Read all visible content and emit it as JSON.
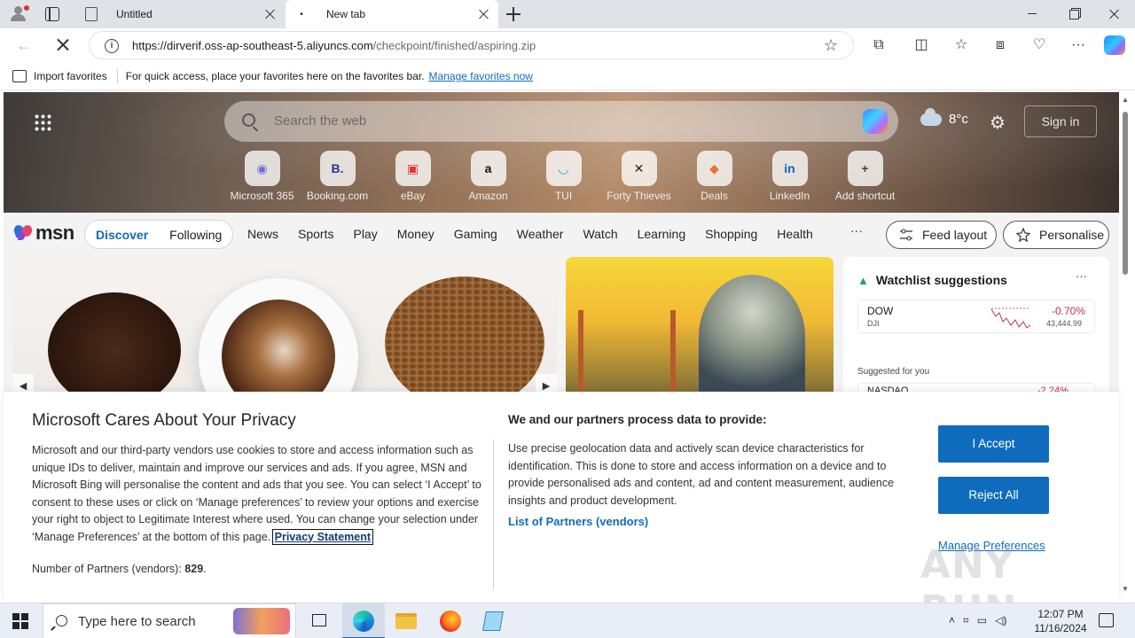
{
  "browser": {
    "tabs": [
      {
        "title": "Untitled",
        "active": false
      },
      {
        "title": "New tab",
        "active": true
      }
    ],
    "address": {
      "host": "https://dirverif.oss-ap-southeast-5.aliyuncs.com",
      "path": "/checkpoint/finished/aspiring.zip"
    },
    "favorites_bar": {
      "import_label": "Import favorites",
      "message": "For quick access, place your favorites here on the favorites bar.",
      "manage_link": "Manage favorites now"
    }
  },
  "msn": {
    "search_placeholder": "Search the web",
    "weather": {
      "temp": "8°c"
    },
    "signin": "Sign in",
    "shortcuts": [
      {
        "label": "Microsoft 365",
        "icon": "microsoft365-icon",
        "glyph": "◉",
        "color": "#6b6fd8"
      },
      {
        "label": "Booking.com",
        "icon": "booking-icon",
        "glyph": "B.",
        "color": "#1d3b8f"
      },
      {
        "label": "eBay",
        "icon": "ebay-icon",
        "glyph": "▣",
        "color": "#e53238"
      },
      {
        "label": "Amazon",
        "icon": "amazon-icon",
        "glyph": "a",
        "color": "#111111"
      },
      {
        "label": "TUI",
        "icon": "tui-icon",
        "glyph": "◡",
        "color": "#2ea8e0"
      },
      {
        "label": "Forty Thieves",
        "icon": "forty-thieves-icon",
        "glyph": "✕",
        "color": "#222222"
      },
      {
        "label": "Deals",
        "icon": "deals-icon",
        "glyph": "◆",
        "color": "#e2733a"
      },
      {
        "label": "LinkedIn",
        "icon": "linkedin-icon",
        "glyph": "in",
        "color": "#0a66c2"
      },
      {
        "label": "Add shortcut",
        "icon": "add-shortcut-icon",
        "glyph": "+",
        "color": "#444444"
      }
    ],
    "logo": "msn",
    "feed_tabs": {
      "active": "Discover",
      "other": "Following"
    },
    "nav": [
      "News",
      "Sports",
      "Play",
      "Money",
      "Gaming",
      "Weather",
      "Watch",
      "Learning",
      "Shopping",
      "Health"
    ],
    "more": "···",
    "feed_layout": "Feed layout",
    "personalise": "Personalise",
    "watchlist": {
      "title": "Watchlist suggestions",
      "stock": {
        "symbol": "DOW",
        "exchange": "DJI",
        "change": "-0.70%",
        "price": "43,444.99"
      },
      "suggested_label": "Suggested for you",
      "stock2": {
        "symbol": "NASDAQ",
        "change": "-2.24%"
      }
    }
  },
  "consent": {
    "title": "Microsoft Cares About Your Privacy",
    "body": "Microsoft and our third-party vendors use cookies to store and access information such as unique IDs to deliver, maintain and improve our services and ads. If you agree, MSN and Microsoft Bing will personalise the content and ads that you see. You can select ‘I Accept’ to consent to these uses or click on ‘Manage preferences’ to review your options and exercise your right to object to Legitimate Interest where used.  You can change your selection under ‘Manage Preferences’ at the bottom of this page.",
    "privacy_link": "Privacy Statement",
    "partners_label": "Number of Partners (vendors):",
    "partners_count": "829",
    "partners_suffix": ".",
    "heading2": "We and our partners process data to provide:",
    "body2": "Use precise geolocation data and actively scan device characteristics for identification. This is done to store and access information on a device and to provide personalised ads and content, ad and content measurement, audience insights and product development.",
    "vendors_link": "List of Partners (vendors)",
    "accept": "I Accept",
    "reject": "Reject All",
    "manage": "Manage Preferences",
    "watermark": "ANY RUN"
  },
  "taskbar": {
    "search_placeholder": "Type here to search",
    "time": "12:07 PM",
    "date": "11/16/2024"
  },
  "colors": {
    "accent": "#0f6cbd",
    "negative": "#c4314b",
    "positive": "#23a55a"
  }
}
